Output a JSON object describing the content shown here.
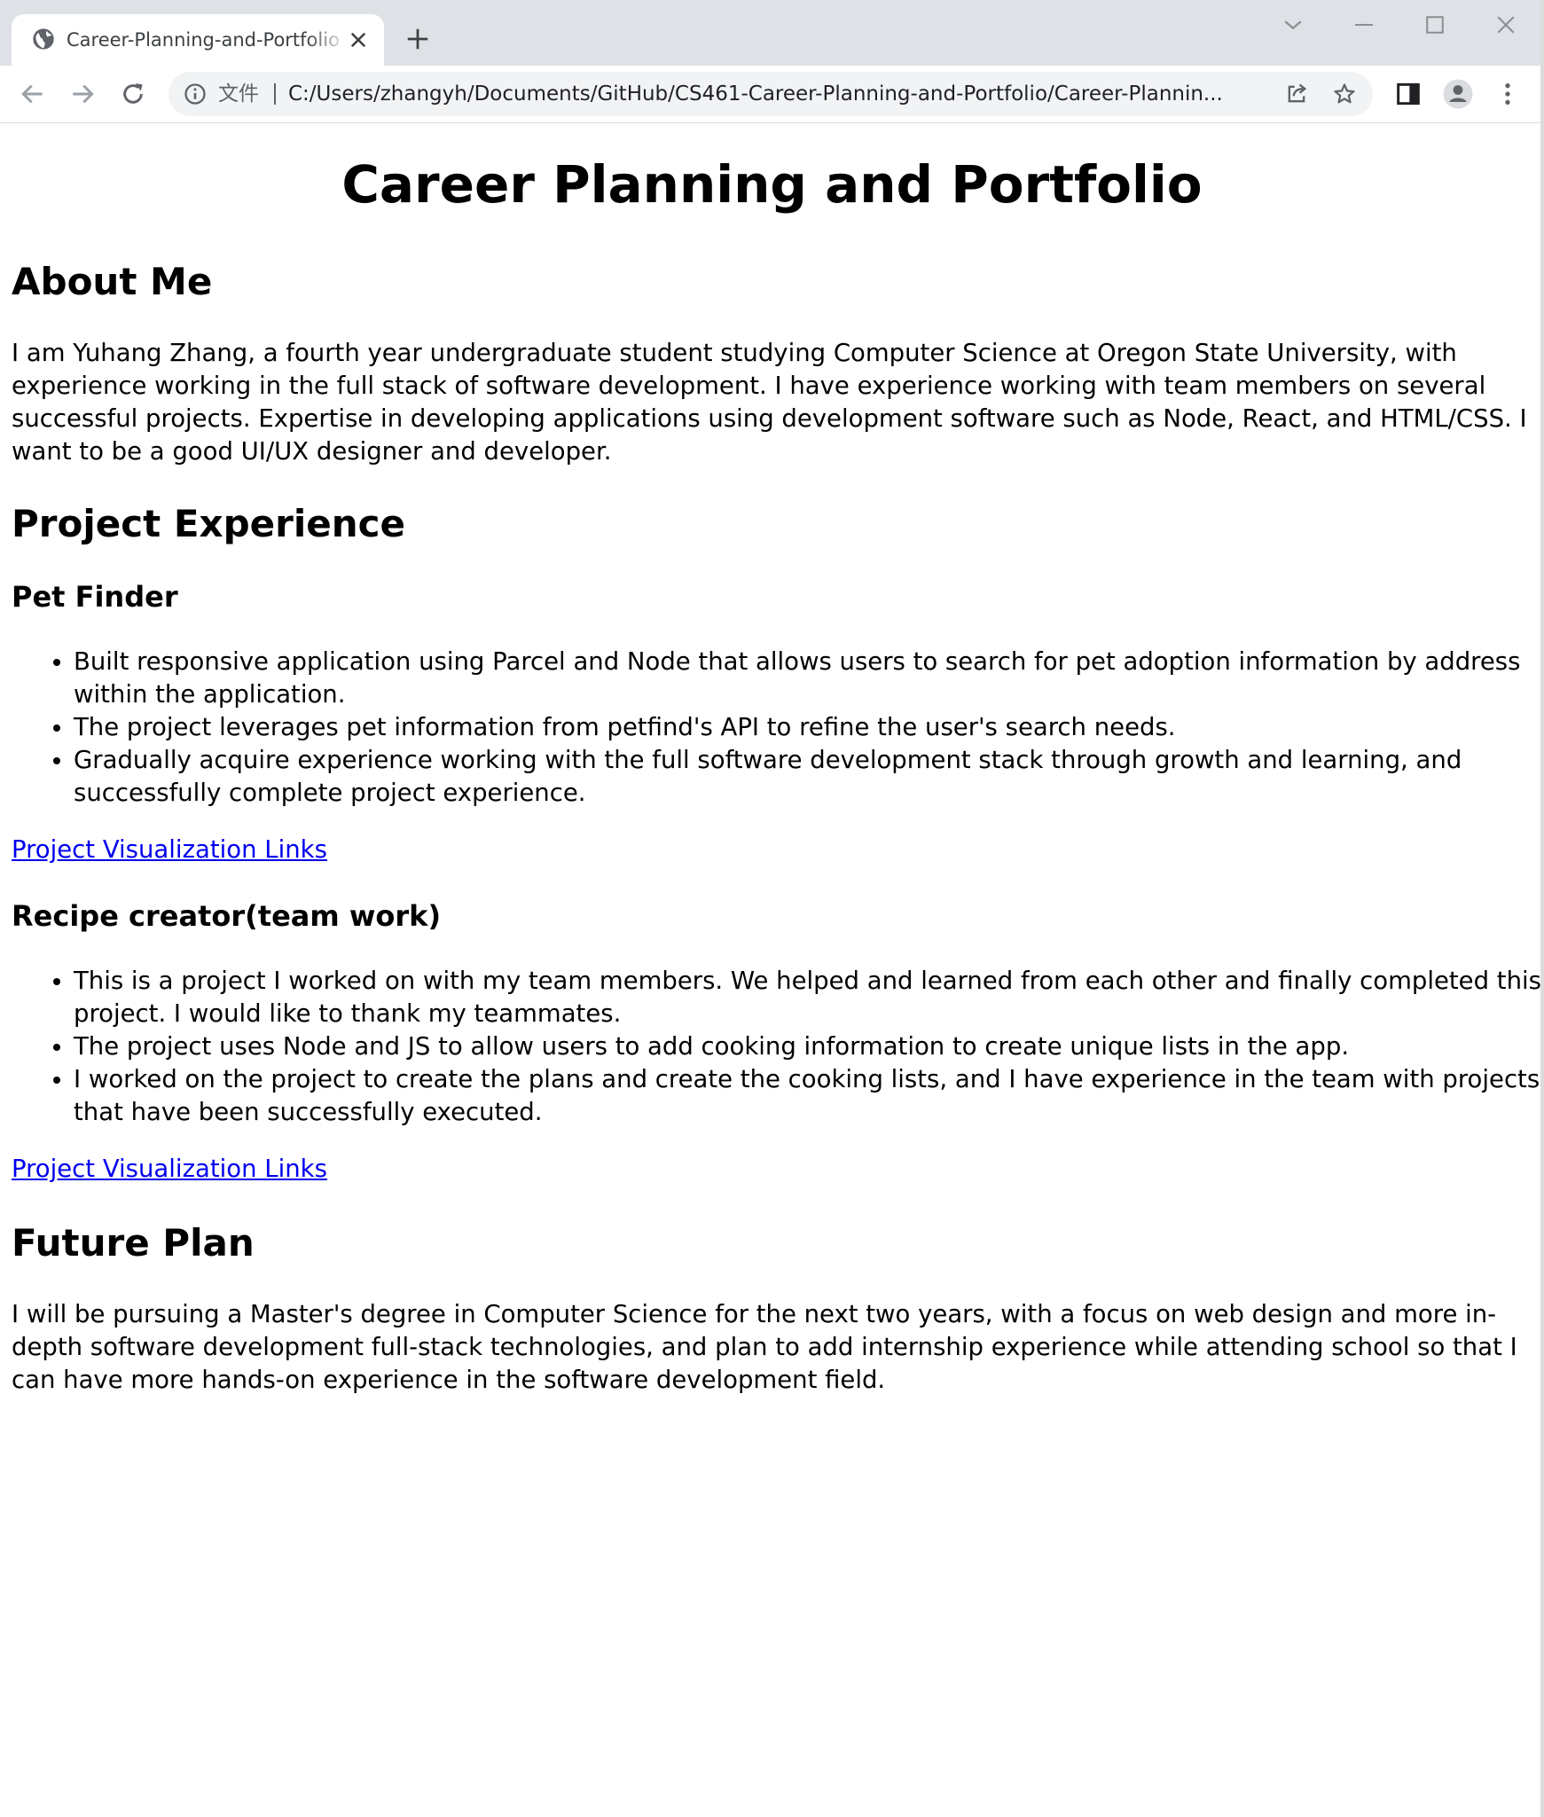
{
  "browser": {
    "tab": {
      "title": "Career-Planning-and-Portfolio",
      "favicon": "globe-icon",
      "close": "close-icon"
    },
    "new_tab": "plus-icon",
    "window_controls": [
      "chevron-down-icon",
      "minimize-icon",
      "maximize-icon",
      "close-icon"
    ],
    "toolbar": {
      "back": "arrow-left-icon",
      "forward": "arrow-right-icon",
      "reload": "reload-icon",
      "scheme_label": "文件",
      "url": "C:/Users/zhangyh/Documents/GitHub/CS461-Career-Planning-and-Portfolio/Career-Plannin...",
      "share": "share-icon",
      "bookmark": "star-icon",
      "side_panel": "side-panel-icon",
      "profile": "profile-icon",
      "menu": "kebab-menu-icon"
    }
  },
  "page": {
    "title": "Career Planning and Portfolio",
    "about": {
      "heading": "About Me",
      "text": "I am Yuhang Zhang, a fourth year undergraduate student studying Computer Science at Oregon State University, with experience working in the full stack of software development. I have experience working with team members on several successful projects. Expertise in developing applications using development software such as Node, React, and HTML/CSS. I want to be a good UI/UX designer and developer."
    },
    "projects": {
      "heading": "Project Experience",
      "items": [
        {
          "name": "Pet Finder",
          "bullets": [
            "Built responsive application using Parcel and Node that allows users to search for pet adoption information by address within the application.",
            "The project leverages pet information from petfind's API to refine the user's search needs.",
            "Gradually acquire experience working with the full software development stack through growth and learning, and successfully complete project experience."
          ],
          "link": "Project Visualization Links"
        },
        {
          "name": "Recipe creator(team work)",
          "bullets": [
            "This is a project I worked on with my team members. We helped and learned from each other and finally completed this project. I would like to thank my teammates.",
            "The project uses Node and JS to allow users to add cooking information to create unique lists in the app.",
            "I worked on the project to create the plans and create the cooking lists, and I have experience in the team with projects that have been successfully executed."
          ],
          "link": "Project Visualization Links"
        }
      ]
    },
    "future": {
      "heading": "Future Plan",
      "text": "I will be pursuing a Master's degree in Computer Science for the next two years, with a focus on web design and more in-depth software development full-stack technologies, and plan to add internship experience while attending school so that I can have more hands-on experience in the software development field."
    }
  },
  "colors": {
    "tabstrip_bg": "#dee1e6",
    "omnibox_bg": "#f1f3f4",
    "link": "#0000ee",
    "icon": "#5f6368"
  }
}
